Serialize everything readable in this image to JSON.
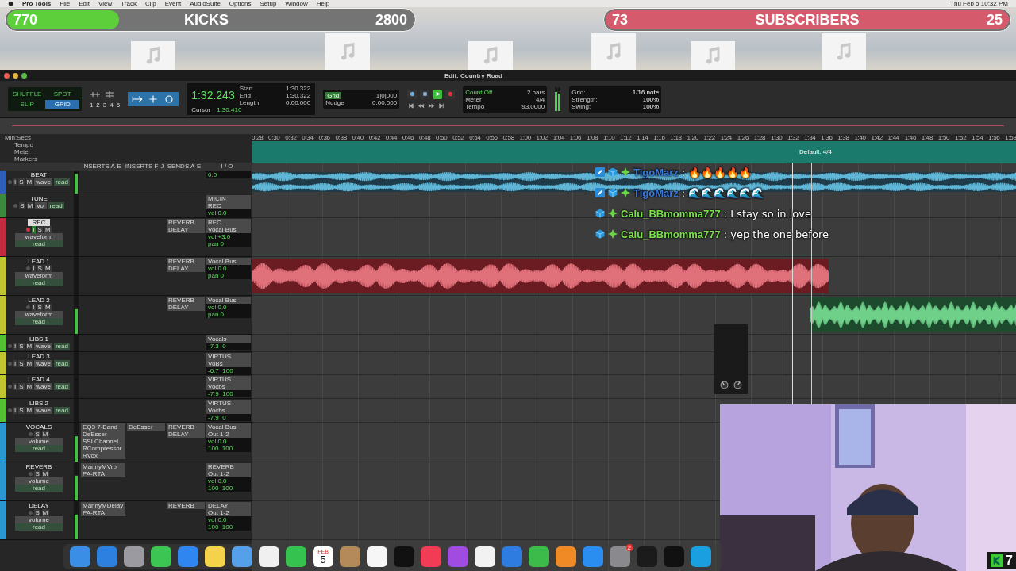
{
  "menu_bar": {
    "app": "Pro Tools",
    "items": [
      "File",
      "Edit",
      "View",
      "Track",
      "Clip",
      "Event",
      "AudioSuite",
      "Options",
      "Setup",
      "Window",
      "Help"
    ],
    "clock": "Thu Feb 5  10:32 PM"
  },
  "goals": [
    {
      "current": "770",
      "label": "KICKS",
      "target": "2800",
      "level": 0.275,
      "color": "#5ccf3a"
    },
    {
      "current": "73",
      "label": "SUBSCRIBERS",
      "target": "25",
      "level": 1,
      "color": "#d45a6c"
    }
  ],
  "window": {
    "title": "Edit: Country Road"
  },
  "toolbar": {
    "modes": [
      {
        "label": "SHUFFLE",
        "selected": false
      },
      {
        "label": "SPOT",
        "selected": false
      },
      {
        "label": "SLIP",
        "selected": false
      },
      {
        "label": "GRID",
        "selected": true
      }
    ],
    "zoom_presets": [
      "1",
      "2",
      "3",
      "4",
      "5"
    ],
    "counter": "1:32.243",
    "cursor_label": "Cursor",
    "cursor_value": "1:30.410",
    "selection": [
      {
        "label": "Start",
        "value": "1:30.322"
      },
      {
        "label": "End",
        "value": "1:30.322"
      },
      {
        "label": "Length",
        "value": "0:00.000"
      }
    ],
    "grid_label": "Grid",
    "grid_value": "1|0|000",
    "nudge_label": "Nudge",
    "nudge_value": "0:00.000",
    "count_off": "Count Off",
    "count_off_value": "2 bars",
    "meter_label": "Meter",
    "meter_value": "4/4",
    "tempo_label": "Tempo",
    "tempo_value": "93.0000",
    "quantize": [
      {
        "label": "Grid:",
        "value": "1/16 note"
      },
      {
        "label": "Strength:",
        "value": "100%"
      },
      {
        "label": "Swing:",
        "value": "100%"
      }
    ]
  },
  "ruler": {
    "label": "Min:Secs",
    "rows": [
      "Tempo",
      "Meter",
      "Markers"
    ],
    "meter_marker": "Default: 4/4",
    "ticks": [
      "0:28",
      "0:30",
      "0:32",
      "0:34",
      "0:36",
      "0:38",
      "0:40",
      "0:42",
      "0:44",
      "0:46",
      "0:48",
      "0:50",
      "0:52",
      "0:54",
      "0:56",
      "0:58",
      "1:00",
      "1:02",
      "1:04",
      "1:06",
      "1:08",
      "1:10",
      "1:12",
      "1:14",
      "1:16",
      "1:18",
      "1:20",
      "1:22",
      "1:24",
      "1:26",
      "1:28",
      "1:30",
      "1:32",
      "1:34",
      "1:36",
      "1:38",
      "1:40",
      "1:42",
      "1:44",
      "1:46",
      "1:48",
      "1:50",
      "1:52",
      "1:54",
      "1:56",
      "1:58"
    ]
  },
  "columns": [
    "INSERTS A-E",
    "INSERTS F-J",
    "SENDS A-E",
    "I / O"
  ],
  "tracks": [
    {
      "name": "BEAT",
      "color": "#2f5fb8",
      "record_armed": false,
      "buttons": [
        "I",
        "S",
        "M"
      ],
      "view": "wave",
      "automation": "read",
      "volume": "0.0",
      "clips": [
        {
          "kind": "stereo"
        }
      ]
    },
    {
      "name": "TUNE",
      "color": "#3d8a3d",
      "record_armed": false,
      "buttons": [
        "S",
        "M"
      ],
      "view": "vol",
      "automation": "read",
      "io": [
        "MICIN",
        "REC"
      ],
      "volume": "vol 0.0"
    },
    {
      "name": "REC",
      "color": "#c42a40",
      "record_armed": true,
      "buttons": [
        "I",
        "S",
        "M"
      ],
      "view": "waveform",
      "automation": "read",
      "sends": [
        "REVERB",
        "DELAY"
      ],
      "io": [
        "REC",
        "Vocal Bus"
      ],
      "volume": "vol +3.0",
      "pan": "pan 0"
    },
    {
      "name": "LEAD 1",
      "color": "#bfc52e",
      "record_armed": false,
      "buttons": [
        "I",
        "S",
        "M"
      ],
      "view": "waveform",
      "automation": "read",
      "sends": [
        "REVERB",
        "DELAY"
      ],
      "io": [
        "Vocal Bus"
      ],
      "volume": "vol 0.0",
      "pan": "pan 0",
      "clips": [
        {
          "kind": "red"
        }
      ]
    },
    {
      "name": "LEAD 2",
      "color": "#bfc52e",
      "record_armed": false,
      "buttons": [
        "I",
        "S",
        "M"
      ],
      "view": "waveform",
      "automation": "read",
      "sends": [
        "REVERB",
        "DELAY"
      ],
      "io": [
        "Vocal Bus"
      ],
      "volume": "vol 0.0",
      "pan": "pan 0",
      "clips": [
        {
          "kind": "green"
        }
      ]
    },
    {
      "name": "LIBS 1",
      "color": "#52c232",
      "record_armed": false,
      "buttons": [
        "I",
        "S",
        "M"
      ],
      "view": "wave",
      "automation": "read",
      "io": [
        "Vocals"
      ],
      "volume": "-7.3  0"
    },
    {
      "name": "LEAD 3",
      "color": "#bfc52e",
      "record_armed": false,
      "buttons": [
        "I",
        "S",
        "M"
      ],
      "view": "wave",
      "automation": "read",
      "io": [
        "VIRTUS",
        "VoBs"
      ],
      "volume": "-6.7  100"
    },
    {
      "name": "LEAD 4",
      "color": "#bfc52e",
      "record_armed": false,
      "buttons": [
        "I",
        "S",
        "M"
      ],
      "view": "wave",
      "automation": "read",
      "io": [
        "VIRTUS",
        "Vocbs"
      ],
      "volume": "-7.9  100"
    },
    {
      "name": "LIBS 2",
      "color": "#52c232",
      "record_armed": false,
      "buttons": [
        "I",
        "S",
        "M"
      ],
      "view": "wave",
      "automation": "read",
      "io": [
        "VIRTUS",
        "Vocbs"
      ],
      "volume": "-7.9  0"
    },
    {
      "name": "VOCALS",
      "color": "#2a98d0",
      "record_armed": false,
      "buttons": [
        "S",
        "M"
      ],
      "view": "volume",
      "automation": "read",
      "inserts_a": [
        "EQ3 7-Band",
        "DeEsser",
        "SSLChannel",
        "RCompressor",
        "RVox"
      ],
      "inserts_f": [
        "DeEsser"
      ],
      "sends": [
        "REVERB",
        "DELAY"
      ],
      "io": [
        "Vocal Bus",
        "Out 1-2"
      ],
      "volume": "vol 0.0",
      "pan": "100  100"
    },
    {
      "name": "REVERB",
      "color": "#2a98d0",
      "record_armed": false,
      "buttons": [
        "S",
        "M"
      ],
      "view": "volume",
      "automation": "read",
      "inserts_a": [
        "MannyMVrb",
        "PA-RTA"
      ],
      "io": [
        "REVERB",
        "Out 1-2"
      ],
      "volume": "vol 0.0",
      "pan": "100  100"
    },
    {
      "name": "DELAY",
      "color": "#2a98d0",
      "record_armed": false,
      "buttons": [
        "S",
        "M"
      ],
      "view": "volume",
      "automation": "read",
      "inserts_a": [
        "MannyMDelay",
        "PA-RTA"
      ],
      "sends": [
        "REVERB"
      ],
      "io": [
        "DELAY",
        "Out 1-2"
      ],
      "volume": "vol 0.0",
      "pan": "100  100"
    }
  ],
  "chat": [
    {
      "user": "TigoMarz",
      "color": "#3a78d8",
      "text": ": 🔥🔥🔥🔥🔥"
    },
    {
      "user": "TigoMarz",
      "color": "#3a78d8",
      "text": ": 🌊🌊🌊🌊🌊🌊"
    },
    {
      "user": "Calu_BBmomma777",
      "color": "#7be04a",
      "text": ": I stay so in love"
    },
    {
      "user": "Calu_BBmomma777",
      "color": "#7be04a",
      "text": ": yep the one before"
    }
  ],
  "dock": {
    "calendar_month": "FEB",
    "calendar_day": "5",
    "badge": "2"
  },
  "kicks_counter": "7"
}
